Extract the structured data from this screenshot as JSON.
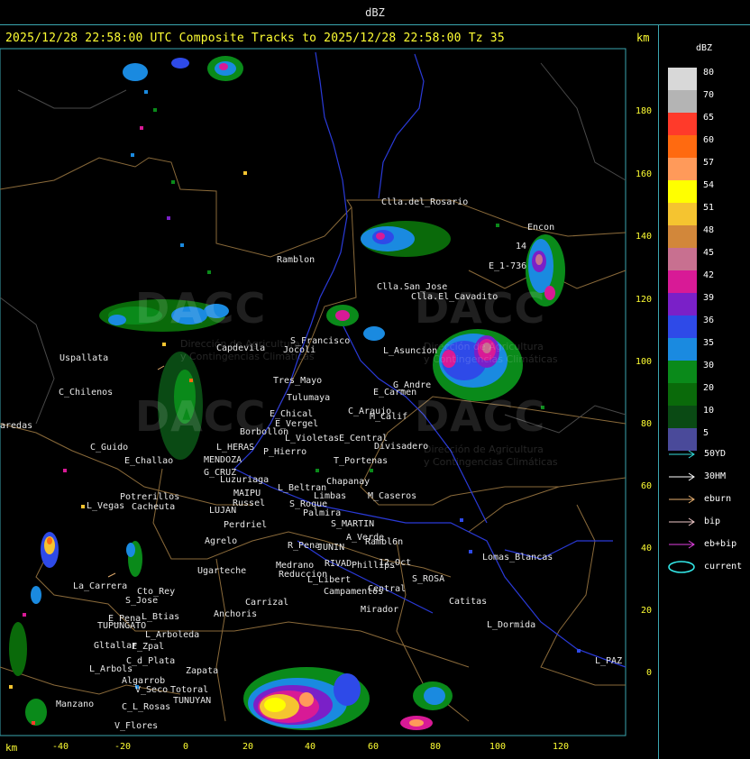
{
  "header": {
    "title": "dBZ",
    "subtitle": "2025/12/28 22:58:00 UTC Composite Tracks to 2025/12/28 22:58:00 Tz 35",
    "km_label_top": "km",
    "km_label_bottom": "km"
  },
  "scale": {
    "title": "dBZ",
    "bins": [
      {
        "label": "80",
        "color": "#d8d8d8"
      },
      {
        "label": "70",
        "color": "#b4b4b4"
      },
      {
        "label": "65",
        "color": "#ff3a2a"
      },
      {
        "label": "60",
        "color": "#ff6a10"
      },
      {
        "label": "57",
        "color": "#ff9a5a"
      },
      {
        "label": "54",
        "color": "#ffff00"
      },
      {
        "label": "51",
        "color": "#f5c430"
      },
      {
        "label": "48",
        "color": "#d2873a"
      },
      {
        "label": "45",
        "color": "#c87090"
      },
      {
        "label": "42",
        "color": "#d81a96"
      },
      {
        "label": "39",
        "color": "#7a20c8"
      },
      {
        "label": "36",
        "color": "#2e4ae8"
      },
      {
        "label": "35",
        "color": "#1a8ae0"
      },
      {
        "label": "30",
        "color": "#0a8a1a"
      },
      {
        "label": "20",
        "color": "#0a6a0a"
      },
      {
        "label": "10",
        "color": "#0a4a14"
      },
      {
        "label": "5",
        "color": "#4a4a9a"
      }
    ]
  },
  "legend": [
    {
      "label": "50YD",
      "color": "#33dddd",
      "type": "arrow"
    },
    {
      "label": "30HM",
      "color": "#ffffff",
      "type": "arrow"
    },
    {
      "label": "eburn",
      "color": "#e8b070",
      "type": "arrow"
    },
    {
      "label": "bip",
      "color": "#f0c8c8",
      "type": "arrow"
    },
    {
      "label": "eb+bip",
      "color": "#e040e0",
      "type": "arrow"
    },
    {
      "label": "current",
      "color": "#33e8e8",
      "type": "ellipse"
    }
  ],
  "axes": {
    "y_ticks": [
      "180",
      "160",
      "140",
      "120",
      "100",
      "80",
      "60",
      "40",
      "20",
      "0"
    ],
    "x_ticks": [
      "-40",
      "-20",
      "0",
      "20",
      "40",
      "60",
      "80",
      "100",
      "120"
    ],
    "x_unit": "km",
    "y_unit": "km"
  },
  "places": [
    {
      "name": "Clla.del_Rosario"
    },
    {
      "name": "Encon"
    },
    {
      "name": "14"
    },
    {
      "name": "E_1-736"
    },
    {
      "name": "Ramblon"
    },
    {
      "name": "Clla.San_Jose"
    },
    {
      "name": "Clla.El_Cavadito"
    },
    {
      "name": "S_Francisco"
    },
    {
      "name": "Jocoli"
    },
    {
      "name": "L_Asuncion"
    },
    {
      "name": "Capdevila"
    },
    {
      "name": "Uspallata"
    },
    {
      "name": "Tres_Mayo"
    },
    {
      "name": "Tulumaya"
    },
    {
      "name": "G_Andre"
    },
    {
      "name": "E_Carmen"
    },
    {
      "name": "C_Chilenos"
    },
    {
      "name": "E_Chical"
    },
    {
      "name": "E_Vergel"
    },
    {
      "name": "C_Araujo"
    },
    {
      "name": "M_Calif"
    },
    {
      "name": "aredas"
    },
    {
      "name": "Borbollon"
    },
    {
      "name": "L_Violetas"
    },
    {
      "name": "E_Central"
    },
    {
      "name": "Divisadero"
    },
    {
      "name": "C_Guido"
    },
    {
      "name": "L_HERAS"
    },
    {
      "name": "P_Hierro"
    },
    {
      "name": "MENDOZA"
    },
    {
      "name": "E_Challao"
    },
    {
      "name": "T_Portenas"
    },
    {
      "name": "G_CRUZ"
    },
    {
      "name": "Luzuriaga"
    },
    {
      "name": "Chapanay"
    },
    {
      "name": "L_Beltran"
    },
    {
      "name": "MAIPU"
    },
    {
      "name": "Russel"
    },
    {
      "name": "Limbas"
    },
    {
      "name": "M_Caseros"
    },
    {
      "name": "Potrerillos"
    },
    {
      "name": "L_Vegas"
    },
    {
      "name": "Cacheuta"
    },
    {
      "name": "LUJAN"
    },
    {
      "name": "S_Roque"
    },
    {
      "name": "Palmira"
    },
    {
      "name": "S_MARTIN"
    },
    {
      "name": "Perdriel"
    },
    {
      "name": "A_Verde"
    },
    {
      "name": "Rambl6n"
    },
    {
      "name": "Agrelo"
    },
    {
      "name": "R_Pena"
    },
    {
      "name": "JUNIN"
    },
    {
      "name": "12_Oct"
    },
    {
      "name": "Lomas_Blancas"
    },
    {
      "name": "Ugarteche"
    },
    {
      "name": "Medrano"
    },
    {
      "name": "RIVAD"
    },
    {
      "name": "Phillips"
    },
    {
      "name": "Reduccion"
    },
    {
      "name": "S_ROSA"
    },
    {
      "name": "L_Libert"
    },
    {
      "name": "La_Carrera"
    },
    {
      "name": "Cto_Rey"
    },
    {
      "name": "Campamentos"
    },
    {
      "name": "Central"
    },
    {
      "name": "S_Jose"
    },
    {
      "name": "Catitas"
    },
    {
      "name": "Carrizal"
    },
    {
      "name": "E_Pena"
    },
    {
      "name": "L_Btias"
    },
    {
      "name": "Anchoris"
    },
    {
      "name": "Mirador"
    },
    {
      "name": "TUPUNGATO"
    },
    {
      "name": "L_Dormida"
    },
    {
      "name": "L_Arboleda"
    },
    {
      "name": "Gltallar"
    },
    {
      "name": "E_Zpal"
    },
    {
      "name": "C_d_Plata"
    },
    {
      "name": "L_Arbols"
    },
    {
      "name": "Zapata"
    },
    {
      "name": "L_PAZ"
    },
    {
      "name": "Algarrob"
    },
    {
      "name": "V_Seco"
    },
    {
      "name": "Totoral"
    },
    {
      "name": "Manzano"
    },
    {
      "name": "C_L_Rosas"
    },
    {
      "name": "TUNUYAN"
    },
    {
      "name": "V_Flores"
    }
  ],
  "watermark": {
    "brand": "DACC",
    "tagline_1": "Dirección de Agricultura",
    "tagline_2": "y Contingencias Climáticas"
  }
}
